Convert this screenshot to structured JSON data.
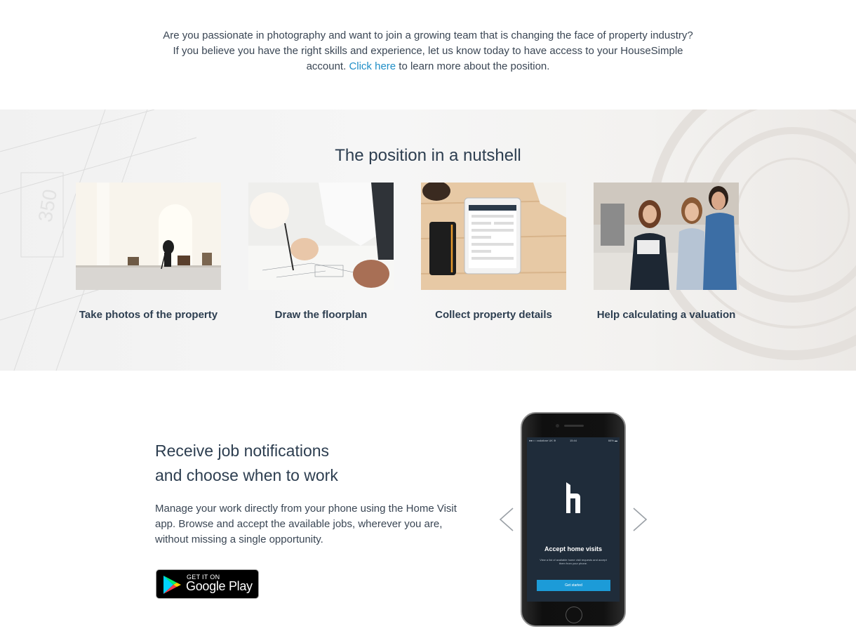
{
  "intro": {
    "line1": "Are you passionate in photography and want to join a growing team that is changing the face of property industry?",
    "line2": "If you believe you have the right skills and experience, let us know today to have access to your HouseSimple",
    "line3_before": "account. ",
    "link_text": "Click here",
    "line3_after": " to learn more about the position."
  },
  "nutshell": {
    "title": "The position in a nutshell",
    "cards": [
      {
        "caption": "Take photos of the property"
      },
      {
        "caption": "Draw the floorplan"
      },
      {
        "caption": "Collect property details"
      },
      {
        "caption": "Help calculating a valuation"
      }
    ]
  },
  "app": {
    "heading_line1": "Receive job notifications",
    "heading_line2": "and choose when to work",
    "description": "Manage your work directly from your phone using the Home Visit app. Browse and accept the available jobs, wherever you are, without missing a single opportunity.",
    "store_badge": {
      "small": "GET IT ON",
      "big": "Google Play"
    },
    "phone": {
      "carrier": "●●○○ vodafone UK ≋",
      "time": "15:44",
      "battery": "66% ▬",
      "title": "Accept home visits",
      "subtitle": "View a list of available home visit requests and accept them from your phone.",
      "cta": "Get started"
    }
  },
  "colors": {
    "link": "#1f8ec7",
    "text": "#2d3e50",
    "phone_screen": "#1f2c3a",
    "cta": "#1c9bd8"
  }
}
